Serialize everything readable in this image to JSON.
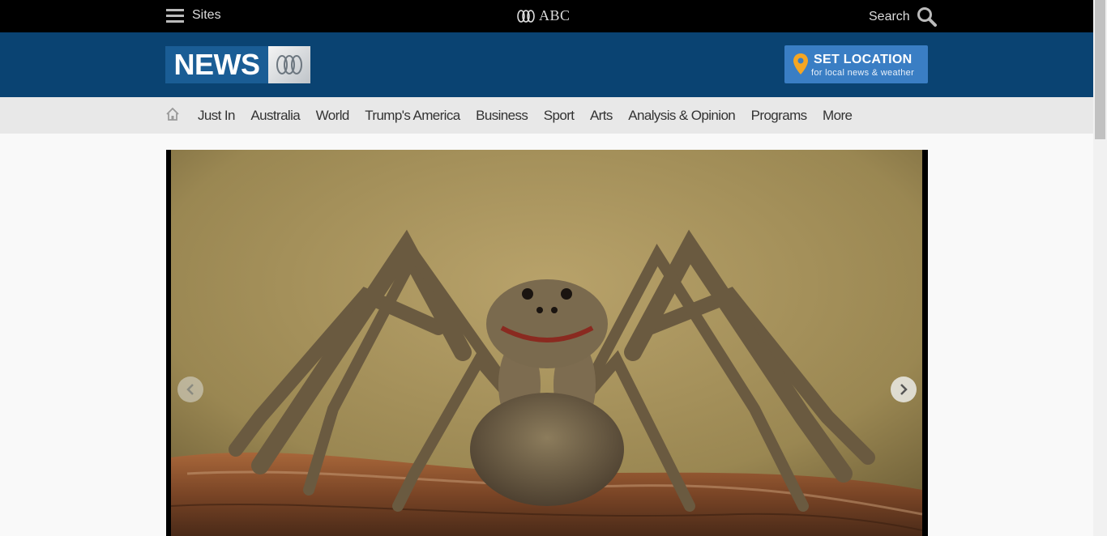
{
  "topbar": {
    "sites_label": "Sites",
    "brand_text": "ABC",
    "search_label": "Search"
  },
  "header": {
    "news_logo_text": "NEWS",
    "set_location": {
      "title": "SET LOCATION",
      "subtitle": "for local news & weather"
    }
  },
  "nav": {
    "items": [
      {
        "label": "Just In"
      },
      {
        "label": "Australia"
      },
      {
        "label": "World"
      },
      {
        "label": "Trump's America"
      },
      {
        "label": "Business"
      },
      {
        "label": "Sport"
      },
      {
        "label": "Arts"
      },
      {
        "label": "Analysis & Opinion"
      },
      {
        "label": "Programs"
      },
      {
        "label": "More"
      }
    ]
  },
  "colors": {
    "topbar_bg": "#000000",
    "header_bg": "#0a4372",
    "location_button_bg": "#3a7ec4",
    "nav_bg": "#e8e8e8",
    "pin_color": "#f5a623"
  },
  "hero": {
    "icons": [
      "chevron-left-icon",
      "chevron-right-icon"
    ]
  }
}
